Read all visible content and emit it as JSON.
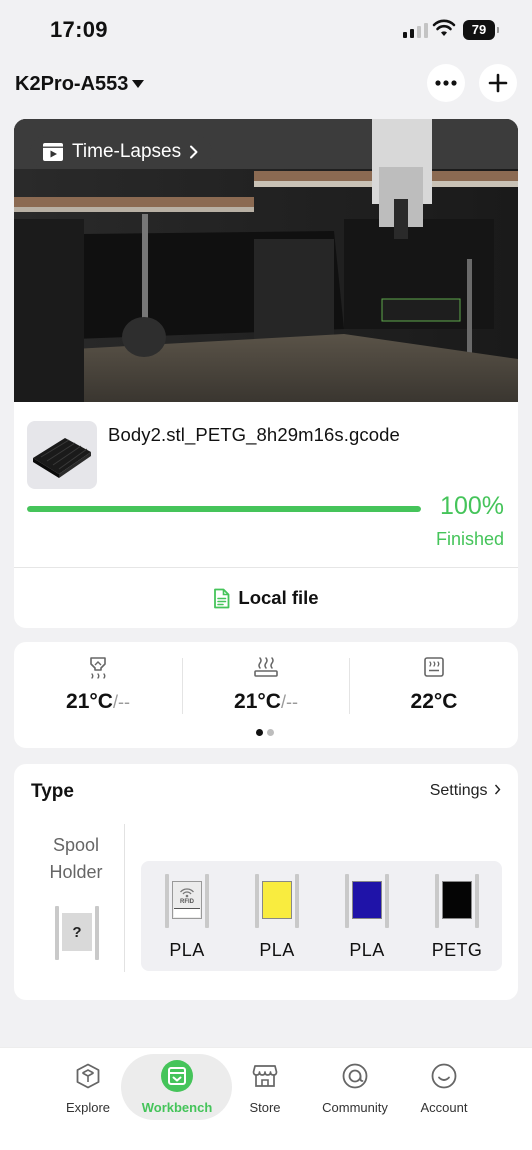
{
  "status_bar": {
    "time": "17:09",
    "battery": "79"
  },
  "header": {
    "device_name": "K2Pro-A553"
  },
  "camera": {
    "timelapse_label": "Time-Lapses"
  },
  "job": {
    "file_name": "Body2.stl_PETG_8h29m16s.gcode",
    "progress_percent": 100,
    "progress_label": "100%",
    "status": "Finished",
    "source_label": "Local file"
  },
  "temps": {
    "items": [
      {
        "icon": "nozzle-icon",
        "value": "21°C",
        "target": "/--"
      },
      {
        "icon": "bed-icon",
        "value": "21°C",
        "target": "/--"
      },
      {
        "icon": "chamber-icon",
        "value": "22°C",
        "target": ""
      }
    ],
    "page_count": 2,
    "active_page": 0
  },
  "filament": {
    "title": "Type",
    "settings_label": "Settings",
    "spool_holder_label_1": "Spool",
    "spool_holder_label_2": "Holder",
    "spool_holder_value": "?",
    "rfid_text": "RFID",
    "slots": [
      {
        "label": "PLA",
        "color": "rfid"
      },
      {
        "label": "PLA",
        "color": "#f9ec3f"
      },
      {
        "label": "PLA",
        "color": "#1f13a8"
      },
      {
        "label": "PETG",
        "color": "#050505"
      }
    ]
  },
  "tabbar": {
    "tabs": [
      {
        "label": "Explore",
        "icon": "cube-icon"
      },
      {
        "label": "Workbench",
        "icon": "workbench-icon"
      },
      {
        "label": "Store",
        "icon": "store-icon"
      },
      {
        "label": "Community",
        "icon": "community-icon"
      },
      {
        "label": "Account",
        "icon": "smile-icon"
      }
    ],
    "active": 1
  },
  "colors": {
    "accent": "#45c45a",
    "background": "#f1f1f3"
  }
}
